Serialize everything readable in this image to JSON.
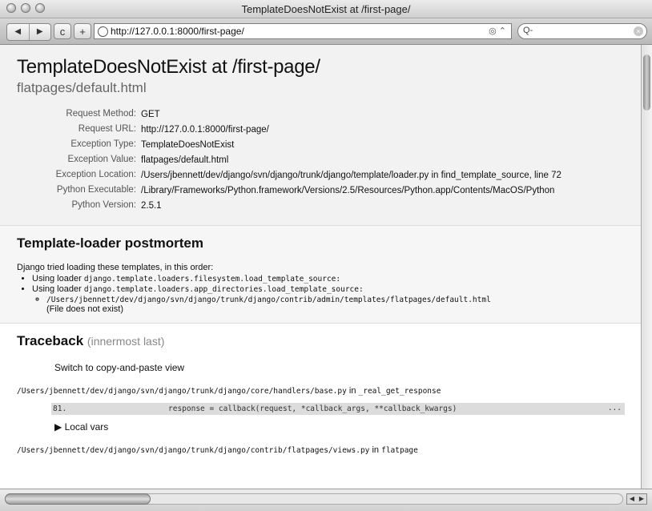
{
  "window": {
    "title": "TemplateDoesNotExist at /first-page/"
  },
  "toolbar": {
    "back_icon": "back-arrow-icon",
    "forward_icon": "forward-arrow-icon",
    "reload_glyph": "c",
    "add_glyph": "+",
    "url": "http://127.0.0.1:8000/first-page/",
    "url_right": "◎ ⌃",
    "search_glyph": "Q-",
    "back_glyph": "◀",
    "forward_glyph": "▶"
  },
  "summary": {
    "title": "TemplateDoesNotExist at /first-page/",
    "subtitle": "flatpages/default.html",
    "rows": [
      {
        "key": "Request Method:",
        "value": "GET"
      },
      {
        "key": "Request URL:",
        "value": "http://127.0.0.1:8000/first-page/"
      },
      {
        "key": "Exception Type:",
        "value": "TemplateDoesNotExist"
      },
      {
        "key": "Exception Value:",
        "value": "flatpages/default.html"
      },
      {
        "key": "Exception Location:",
        "value": "/Users/jbennett/dev/django/svn/django/trunk/django/template/loader.py in find_template_source, line 72"
      },
      {
        "key": "Python Executable:",
        "value": "/Library/Frameworks/Python.framework/Versions/2.5/Resources/Python.app/Contents/MacOS/Python"
      },
      {
        "key": "Python Version:",
        "value": "2.5.1"
      }
    ]
  },
  "postmortem": {
    "heading": "Template-loader postmortem",
    "intro": "Django tried loading these templates, in this order:",
    "loader_prefix": "Using loader ",
    "loaders": [
      "django.template.loaders.filesystem.load_template_source:",
      "django.template.loaders.app_directories.load_template_source:"
    ],
    "tried_path": "/Users/jbennett/dev/django/svn/django/trunk/django/contrib/admin/templates/flatpages/default.html",
    "tried_status": "(File does not exist)"
  },
  "traceback": {
    "heading": "Traceback",
    "heading_note": "(innermost last)",
    "switch_link": "Switch to copy-and-paste view",
    "frame1_path": "/Users/jbennett/dev/django/svn/django/trunk/django/core/handlers/base.py",
    "frame1_in": " in ",
    "frame1_func": "_real_get_response",
    "line_no": "81.",
    "line_code": "response = callback(request, *callback_args, **callback_kwargs)",
    "line_more": "...",
    "local_vars": "▶ Local vars",
    "frame2_path": "/Users/jbennett/dev/django/svn/django/trunk/django/contrib/flatpages/views.py",
    "frame2_in": " in ",
    "frame2_func": "flatpage"
  },
  "scrollbar": {
    "left_arrow": "◀",
    "right_arrow": "▶"
  }
}
